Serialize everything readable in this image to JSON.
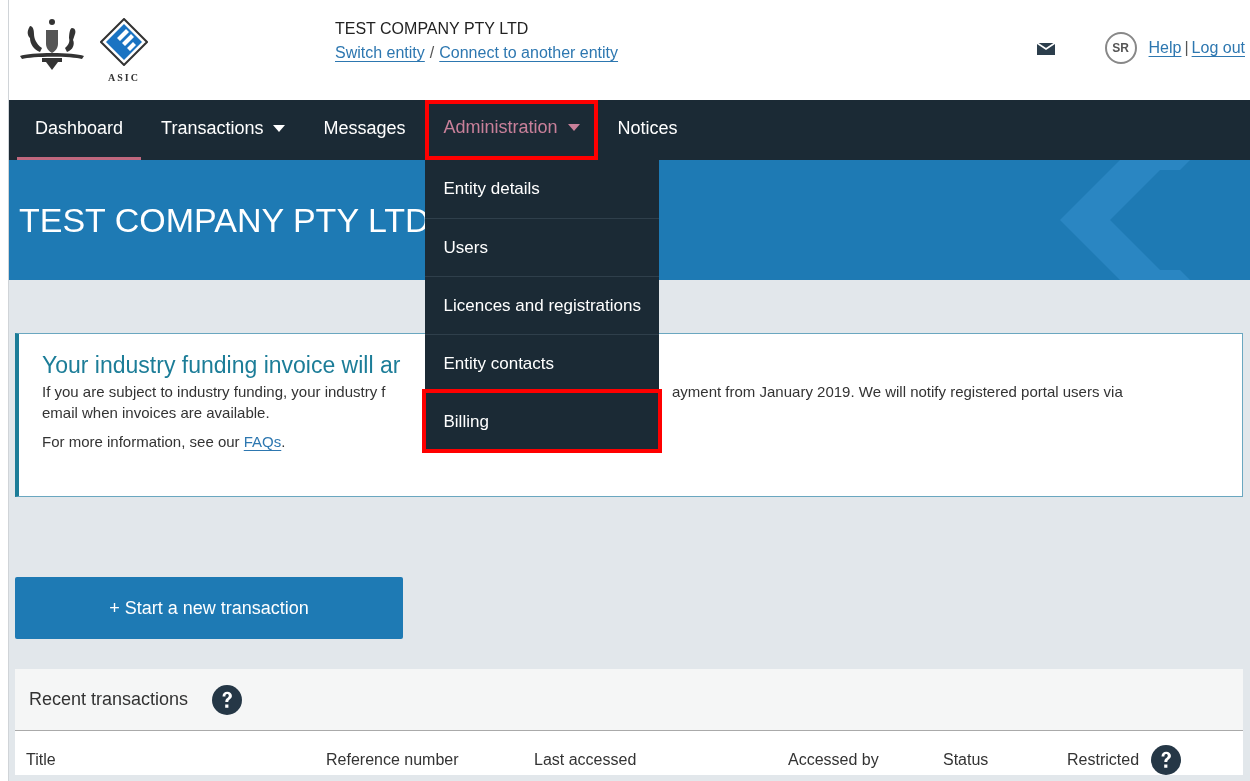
{
  "header": {
    "entity_name": "TEST COMPANY PTY LTD",
    "logo_text": "ASIC",
    "entity_links": [
      {
        "label": "Switch entity"
      },
      {
        "label": "Connect to another entity"
      }
    ],
    "link_separator": "/",
    "avatar": "SR",
    "user_links": [
      {
        "label": "Help"
      },
      {
        "label": "Log out"
      }
    ],
    "user_separator": "|"
  },
  "nav": {
    "items": [
      {
        "label": "Dashboard",
        "selected": true,
        "dropdown": false,
        "open": false,
        "highlighted": false
      },
      {
        "label": "Transactions",
        "selected": false,
        "dropdown": true,
        "open": false,
        "highlighted": false
      },
      {
        "label": "Messages",
        "selected": false,
        "dropdown": false,
        "open": false,
        "highlighted": false
      },
      {
        "label": "Administration",
        "selected": false,
        "dropdown": true,
        "open": true,
        "highlighted": true,
        "menu": [
          {
            "label": "Entity details",
            "highlighted": false
          },
          {
            "label": "Users",
            "highlighted": false
          },
          {
            "label": "Licences and registrations",
            "highlighted": false
          },
          {
            "label": "Entity contacts",
            "highlighted": false
          },
          {
            "label": "Billing",
            "highlighted": true
          }
        ]
      },
      {
        "label": "Notices",
        "selected": false,
        "dropdown": false,
        "open": false,
        "highlighted": false
      }
    ]
  },
  "banner": {
    "title": "TEST COMPANY PTY LTD"
  },
  "alert": {
    "title": "Your industry funding invoice will ar",
    "line_1_left": "If you are subject to industry funding, your industry f",
    "line_1_right": "ayment from  January 2019. We will notify registered portal users via",
    "line_2": "email when invoices are available.",
    "more_text": "For more information, see our ",
    "more_link": "FAQs",
    "more_end": "."
  },
  "start_button": "+ Start a new transaction",
  "recent": {
    "title": "Recent transactions",
    "columns": [
      {
        "label": "Title",
        "help": false
      },
      {
        "label": "Reference number",
        "help": false
      },
      {
        "label": "Last accessed",
        "help": false
      },
      {
        "label": "Accessed by",
        "help": false
      },
      {
        "label": "Status",
        "help": false
      },
      {
        "label": "Restricted",
        "help": true
      }
    ]
  }
}
